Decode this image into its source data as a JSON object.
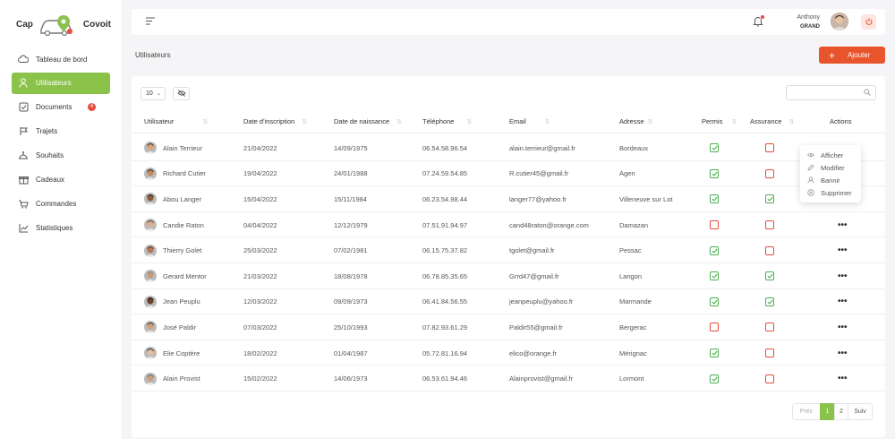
{
  "brand": {
    "left": "Cap",
    "right": "Covoit"
  },
  "colors": {
    "accent": "#8bc34a",
    "primary": "#e8542b",
    "danger": "#e74c3c",
    "success": "#4caf50"
  },
  "sidebar": {
    "items": [
      {
        "label": "Tableau de bord",
        "icon": "cloud-icon"
      },
      {
        "label": "Utilisateurs",
        "icon": "user-icon",
        "active": true
      },
      {
        "label": "Documents",
        "icon": "document-icon",
        "badge": "4"
      },
      {
        "label": "Trajets",
        "icon": "route-icon"
      },
      {
        "label": "Souhaits",
        "icon": "wish-icon"
      },
      {
        "label": "Cadeaux",
        "icon": "gift-icon"
      },
      {
        "label": "Commandes",
        "icon": "cart-icon"
      },
      {
        "label": "Statistiques",
        "icon": "chart-icon"
      }
    ]
  },
  "header": {
    "first_name": "Anthony",
    "last_name": "GRAND"
  },
  "page": {
    "title": "Utilisateurs",
    "add_label": "Ajouter"
  },
  "table": {
    "per_page": "10",
    "search_placeholder": "",
    "columns": [
      "Utilisateur",
      "Date d'inscription",
      "Date de naissance",
      "Téléphone",
      "Email",
      "Adresse",
      "Permis",
      "Assurance",
      "Actions"
    ],
    "rows": [
      {
        "name": "Alain Terrieur",
        "inscription": "21/04/2022",
        "naissance": "14/09/1975",
        "phone": "06.54.58.96.54",
        "email": "alain.terrieur@gmail.fr",
        "address": "Bordeaux",
        "permis": true,
        "assurance": false
      },
      {
        "name": "Richard Cutier",
        "inscription": "19/04/2022",
        "naissance": "24/01/1988",
        "phone": "07.24.59.54.85",
        "email": "R.cutier45@gmail.fr",
        "address": "Agen",
        "permis": true,
        "assurance": false
      },
      {
        "name": "Abou Langer",
        "inscription": "15/04/2022",
        "naissance": "15/11/1984",
        "phone": "06.23.54.98.44",
        "email": "langer77@yahoo.fr",
        "address": "Villeneuve sur Lot",
        "permis": true,
        "assurance": true
      },
      {
        "name": "Candie Raton",
        "inscription": "04/04/2022",
        "naissance": "12/12/1979",
        "phone": "07.51.91.94.97",
        "email": "cand48raton@orange.com",
        "address": "Damazan",
        "permis": false,
        "assurance": false
      },
      {
        "name": "Thierry Golet",
        "inscription": "25/03/2022",
        "naissance": "07/02/1981",
        "phone": "06.15.75.37.82",
        "email": "tgolet@gmail.fr",
        "address": "Pessac",
        "permis": true,
        "assurance": false
      },
      {
        "name": "Gerard Mentor",
        "inscription": "21/03/2022",
        "naissance": "18/08/1978",
        "phone": "06.78.85.35.65",
        "email": "Grrd47@gmail.fr",
        "address": "Langon",
        "permis": true,
        "assurance": true
      },
      {
        "name": "Jean Peuplu",
        "inscription": "12/03/2022",
        "naissance": "09/09/1973",
        "phone": "06.41.84.56.55",
        "email": "jeanpeuplu@yahoo.fr",
        "address": "Marmande",
        "permis": true,
        "assurance": true
      },
      {
        "name": "José Paldir",
        "inscription": "07/03/2022",
        "naissance": "25/10/1993",
        "phone": "07.82.93.61.29",
        "email": "Paldir55@gmail.fr",
        "address": "Bergerac",
        "permis": false,
        "assurance": false
      },
      {
        "name": "Elie Coptère",
        "inscription": "18/02/2022",
        "naissance": "01/04/1987",
        "phone": "05.72.81.16.94",
        "email": "elico@orange.fr",
        "address": "Mérignac",
        "permis": true,
        "assurance": false
      },
      {
        "name": "Alain Provist",
        "inscription": "15/02/2022",
        "naissance": "14/06/1973",
        "phone": "06.53.61.94.46",
        "email": "Alainprovist@gmail.fr",
        "address": "Lormont",
        "permis": true,
        "assurance": false
      }
    ]
  },
  "actions_menu": [
    "Afficher",
    "Modifier",
    "Bannir",
    "Supprimer"
  ],
  "pagination": {
    "prev": "Préc",
    "pages": [
      "1",
      "2"
    ],
    "next": "Suiv",
    "current": "1"
  }
}
